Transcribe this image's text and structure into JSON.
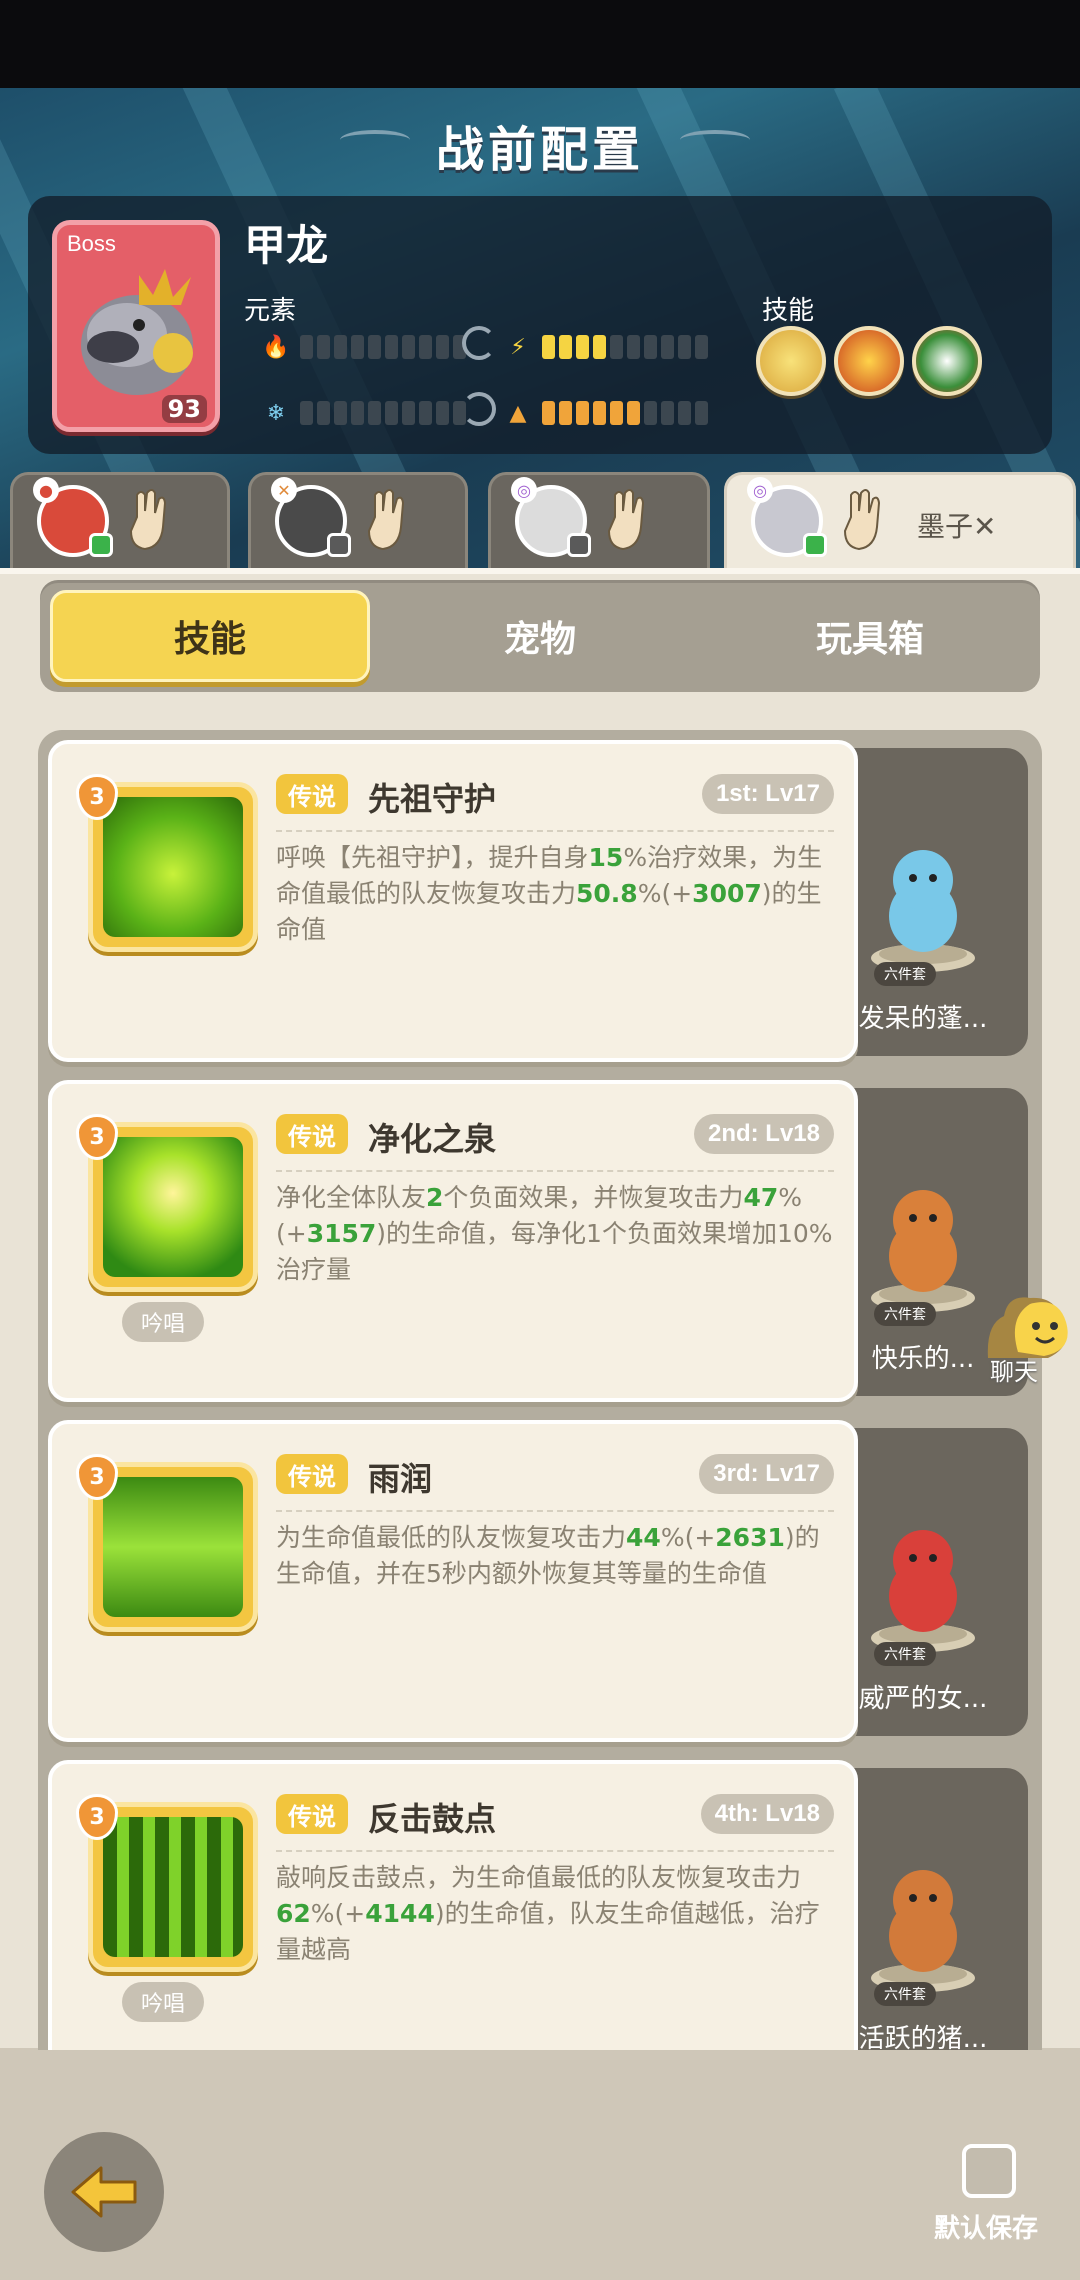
{
  "header": {
    "title": "战前配置"
  },
  "boss": {
    "tag": "Boss",
    "name": "甲龙",
    "level": "93",
    "element_label": "元素",
    "skill_label": "技能"
  },
  "heroes": [
    {
      "name": "",
      "element_icon": "fire-icon"
    },
    {
      "name": "",
      "element_icon": "slash-icon"
    },
    {
      "name": "",
      "element_icon": "wind-icon"
    },
    {
      "name": "墨子",
      "element_icon": "wind-icon",
      "close_label": "✕"
    }
  ],
  "tabs": [
    {
      "label": "技能"
    },
    {
      "label": "宠物"
    },
    {
      "label": "玩具箱"
    }
  ],
  "skills": [
    {
      "level": "3",
      "rarity": "传说",
      "name": "先祖守护",
      "rank": "1st: Lv17",
      "chant": "",
      "desc_parts": [
        "呼唤【先祖守护】，提升自身",
        "15",
        "%治疗效果，为生命值最低的队友恢复攻击力",
        "50.8",
        "%(+",
        "3007",
        ")的生命值"
      ],
      "pet": {
        "set": "六件套",
        "name": "发呆的蓬..."
      }
    },
    {
      "level": "3",
      "rarity": "传说",
      "name": "净化之泉",
      "rank": "2nd: Lv18",
      "chant": "吟唱",
      "desc_parts": [
        "净化全体队友",
        "2",
        "个负面效果，并恢复攻击力",
        "47",
        "%(+",
        "3157",
        ")的生命值，每净化1个负面效果增加10%治疗量"
      ],
      "pet": {
        "set": "六件套",
        "name": "快乐的..."
      }
    },
    {
      "level": "3",
      "rarity": "传说",
      "name": "雨润",
      "rank": "3rd: Lv17",
      "chant": "",
      "desc_parts": [
        "为生命值最低的队友恢复攻击力",
        "44",
        "%(+",
        "2631",
        ")的生命值，并在5秒内额外恢复其等量的生命值"
      ],
      "pet": {
        "set": "六件套",
        "name": "威严的女..."
      }
    },
    {
      "level": "3",
      "rarity": "传说",
      "name": "反击鼓点",
      "rank": "4th: Lv18",
      "chant": "吟唱",
      "desc_parts": [
        "敲响反击鼓点，为生命值最低的队友恢复攻击力",
        "62",
        "%(+",
        "4144",
        ")的生命值，队友生命值越低，治疗量越高"
      ],
      "pet": {
        "set": "六件套",
        "name": "活跃的猪..."
      }
    }
  ],
  "chat": {
    "label": "聊天"
  },
  "footer": {
    "save_label": "默认保存"
  },
  "colors": {
    "accent": "#f5d451",
    "legend": "#f2c53d",
    "heal_green": "#3aa23a"
  }
}
